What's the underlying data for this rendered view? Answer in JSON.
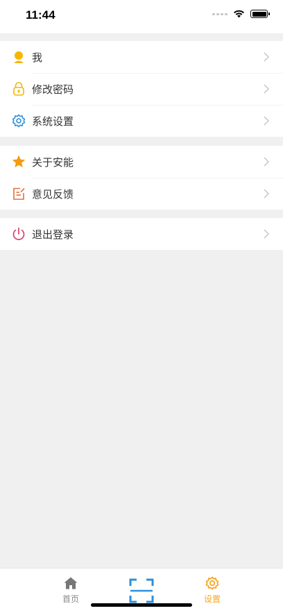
{
  "status_bar": {
    "time": "11:44"
  },
  "colors": {
    "page_bg": "#f0f0f0",
    "accent_orange": "#f5a623",
    "scan_blue": "#2d8fd9",
    "logout_pink": "#d9406b",
    "tab_inactive": "#888888"
  },
  "menu_groups": [
    {
      "items": [
        {
          "label": "我",
          "icon": "user-icon"
        },
        {
          "label": "修改密码",
          "icon": "lock-icon"
        },
        {
          "label": "系统设置",
          "icon": "gear-icon"
        }
      ]
    },
    {
      "items": [
        {
          "label": "关于安能",
          "icon": "star-icon"
        },
        {
          "label": "意见反馈",
          "icon": "edit-note-icon"
        }
      ]
    },
    {
      "items": [
        {
          "label": "退出登录",
          "icon": "power-icon"
        }
      ]
    }
  ],
  "tabbar": {
    "tabs": [
      {
        "label": "首页",
        "icon": "home-icon",
        "active": false
      },
      {
        "label": "",
        "icon": "scan-icon",
        "active": false
      },
      {
        "label": "设置",
        "icon": "gear-icon",
        "active": true
      }
    ]
  }
}
